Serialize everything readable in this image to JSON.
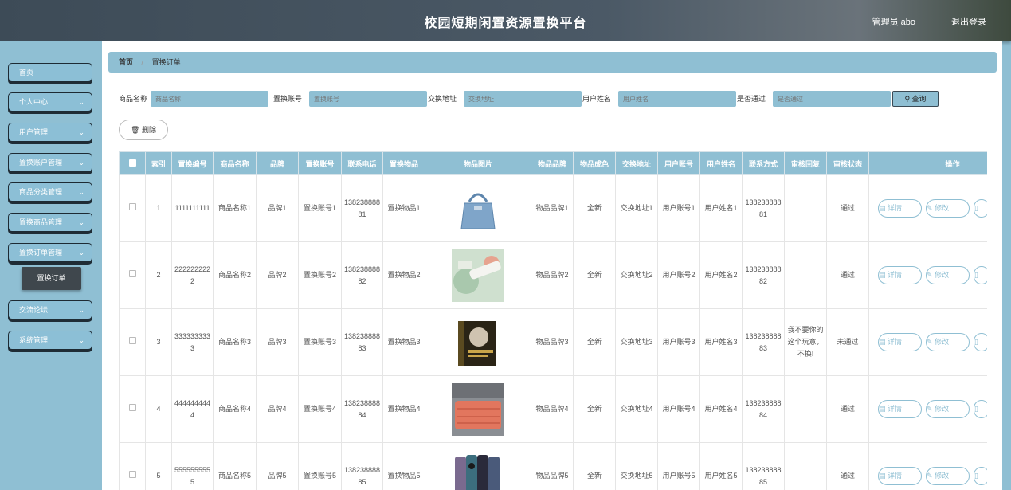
{
  "header": {
    "title": "校园短期闲置资源置换平台",
    "user": "管理员 abo",
    "logout": "退出登录"
  },
  "sidebar": {
    "items": [
      {
        "label": "首页",
        "chev": ""
      },
      {
        "label": "个人中心",
        "chev": "⌄"
      },
      {
        "label": "用户管理",
        "chev": "⌄"
      },
      {
        "label": "置换账户管理",
        "chev": "⌄"
      },
      {
        "label": "商品分类管理",
        "chev": "⌄"
      },
      {
        "label": "置换商品管理",
        "chev": "⌄"
      },
      {
        "label": "置换订单管理",
        "chev": "⌄"
      },
      {
        "label": "交流论坛",
        "chev": "⌄"
      },
      {
        "label": "系统管理",
        "chev": "⌄"
      }
    ],
    "sub_active": "置换订单"
  },
  "breadcrumb": {
    "home": "首页",
    "sep": "/",
    "current": "置换订单"
  },
  "search": {
    "fields": [
      {
        "label": "商品名称",
        "placeholder": "商品名称"
      },
      {
        "label": "置换账号",
        "placeholder": "置换账号"
      },
      {
        "label": "交换地址",
        "placeholder": "交换地址"
      },
      {
        "label": "用户姓名",
        "placeholder": "用户姓名"
      },
      {
        "label": "是否通过",
        "placeholder": "是否通过"
      }
    ],
    "query_label": "查询"
  },
  "actions": {
    "delete_label": "删除"
  },
  "table": {
    "headers": [
      "",
      "索引",
      "置换编号",
      "商品名称",
      "品牌",
      "置换账号",
      "联系电话",
      "置换物品",
      "物品图片",
      "物品品牌",
      "物品成色",
      "交换地址",
      "用户账号",
      "用户姓名",
      "联系方式",
      "审核回复",
      "审核状态",
      "操作"
    ],
    "rows": [
      {
        "idx": "1",
        "no": "1111111111",
        "name": "商品名称1",
        "brand": "品牌1",
        "acct": "置换账号1",
        "phone": "13823888881",
        "item": "置换物品1",
        "img": "bag-image",
        "ibrand": "物品品牌1",
        "cond": "全新",
        "addr": "交换地址1",
        "uacct": "用户账号1",
        "uname": "用户姓名1",
        "contact": "13823888881",
        "reply": "",
        "status": "通过"
      },
      {
        "idx": "2",
        "no": "2222222222",
        "name": "商品名称2",
        "brand": "品牌2",
        "acct": "置换账号2",
        "phone": "13823888882",
        "item": "置换物品2",
        "img": "cosmetic-image",
        "ibrand": "物品品牌2",
        "cond": "全新",
        "addr": "交换地址2",
        "uacct": "用户账号2",
        "uname": "用户姓名2",
        "contact": "13823888882",
        "reply": "",
        "status": "通过"
      },
      {
        "idx": "3",
        "no": "3333333333",
        "name": "商品名称3",
        "brand": "品牌3",
        "acct": "置换账号3",
        "phone": "13823888883",
        "item": "置换物品3",
        "img": "book-image",
        "ibrand": "物品品牌3",
        "cond": "全新",
        "addr": "交换地址3",
        "uacct": "用户账号3",
        "uname": "用户姓名3",
        "contact": "13823888883",
        "reply": "我不要你的这个玩意，不换!",
        "status": "未通过"
      },
      {
        "idx": "4",
        "no": "4444444444",
        "name": "商品名称4",
        "brand": "品牌4",
        "acct": "置换账号4",
        "phone": "13823888884",
        "item": "置换物品4",
        "img": "quilt-image",
        "ibrand": "物品品牌4",
        "cond": "全新",
        "addr": "交换地址4",
        "uacct": "用户账号4",
        "uname": "用户姓名4",
        "contact": "13823888884",
        "reply": "",
        "status": "通过"
      },
      {
        "idx": "5",
        "no": "5555555555",
        "name": "商品名称5",
        "brand": "品牌5",
        "acct": "置换账号5",
        "phone": "13823888885",
        "item": "置换物品5",
        "img": "phone-image",
        "ibrand": "物品品牌5",
        "cond": "全新",
        "addr": "交换地址5",
        "uacct": "用户账号5",
        "uname": "用户姓名5",
        "contact": "13823888885",
        "reply": "",
        "status": "通过"
      }
    ],
    "op_labels": {
      "detail": "详情",
      "edit": "修改"
    }
  },
  "colors": {
    "accent": "#8fbfd3",
    "header": "#4b5966",
    "sidebar_active": "#3f474d"
  }
}
